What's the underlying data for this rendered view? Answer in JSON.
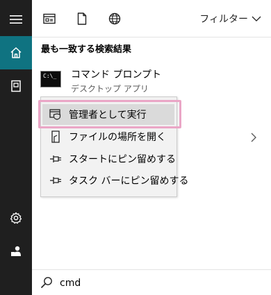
{
  "rail": {
    "items": [
      {
        "name": "hamburger-menu-icon"
      },
      {
        "name": "home-icon",
        "active": true
      },
      {
        "name": "documents-icon"
      },
      {
        "name": "settings-icon"
      },
      {
        "name": "account-icon"
      }
    ],
    "accent_color": "#0f7381",
    "background_color": "#1f1f1f"
  },
  "topbar": {
    "tabs": [
      {
        "icon": "apps-icon"
      },
      {
        "icon": "document-icon"
      },
      {
        "icon": "web-icon"
      }
    ],
    "filter_label": "フィルター"
  },
  "results": {
    "section_title": "最も一致する検索結果",
    "best_match": {
      "icon": "command-prompt-icon",
      "title": "コマンド プロンプト",
      "subtitle": "デスクトップ アプリ"
    }
  },
  "context_menu": {
    "items": [
      {
        "label": "管理者として実行",
        "icon": "run-as-admin-icon",
        "highlighted": true
      },
      {
        "label": "ファイルの場所を開く",
        "icon": "open-file-location-icon"
      },
      {
        "label": "スタートにピン留めする",
        "icon": "pin-icon"
      },
      {
        "label": "タスク バーにピン留めする",
        "icon": "pin-icon"
      }
    ],
    "highlight_outline_color": "#eaa6c6"
  },
  "search": {
    "value": "cmd"
  }
}
